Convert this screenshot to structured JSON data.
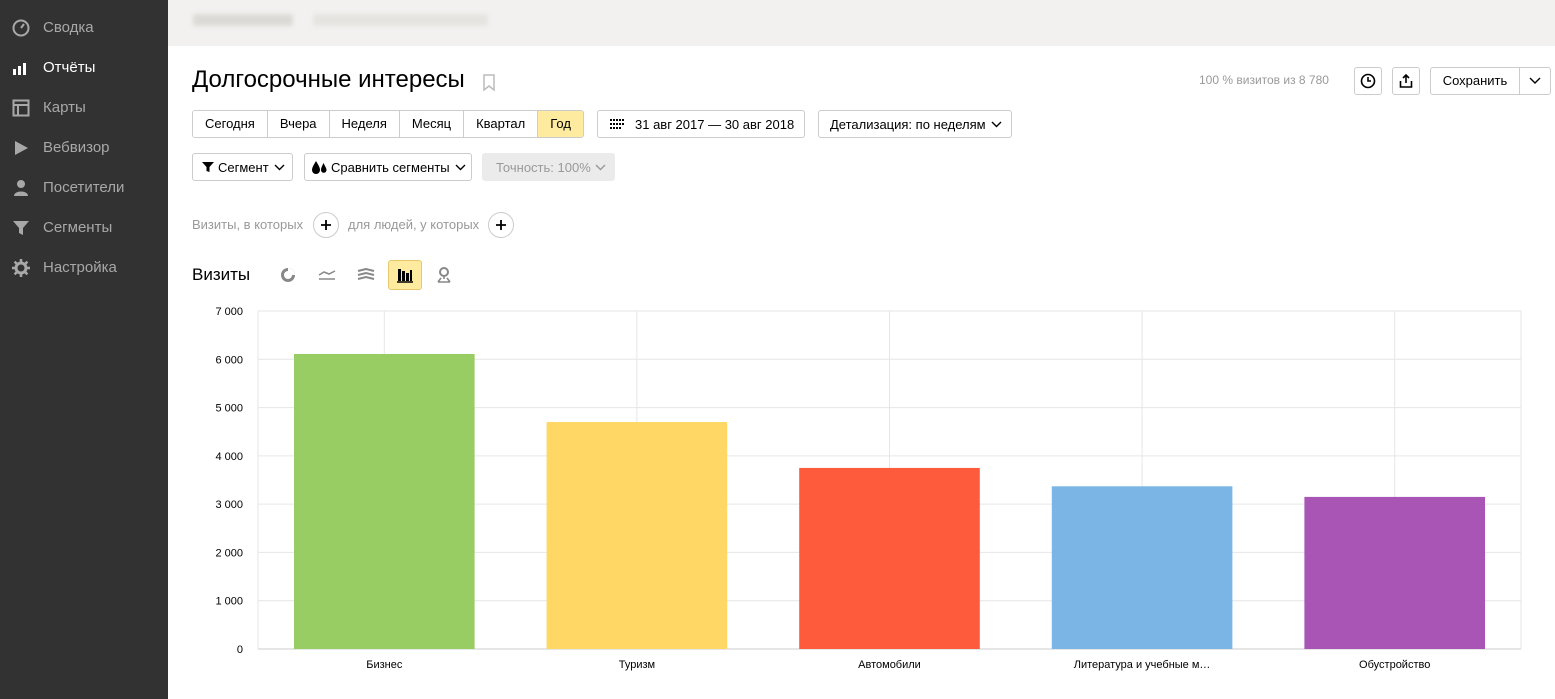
{
  "sidebar": {
    "items": [
      {
        "label": "Сводка",
        "icon": "gauge-icon"
      },
      {
        "label": "Отчёты",
        "icon": "bar-chart-icon",
        "active": true
      },
      {
        "label": "Карты",
        "icon": "map-layout-icon"
      },
      {
        "label": "Вебвизор",
        "icon": "play-icon"
      },
      {
        "label": "Посетители",
        "icon": "person-icon"
      },
      {
        "label": "Сегменты",
        "icon": "funnel-icon"
      },
      {
        "label": "Настройка",
        "icon": "gear-icon"
      }
    ]
  },
  "header": {
    "title": "Долгосрочные интересы",
    "visits_share": "100 % визитов из 8 780",
    "save_label": "Сохранить"
  },
  "period": {
    "options": [
      "Сегодня",
      "Вчера",
      "Неделя",
      "Месяц",
      "Квартал",
      "Год"
    ],
    "selected": "Год",
    "date_range": "31 авг 2017 — 30 авг 2018",
    "detail": "Детализация: по неделям"
  },
  "filters": {
    "segment": "Сегмент",
    "compare": "Сравнить сегменты",
    "accuracy": "Точность: 100%"
  },
  "conditions": {
    "visits_label": "Визиты, в которых",
    "people_label": "для людей, у которых"
  },
  "chart_section": {
    "title": "Визиты",
    "chart_types": [
      "pie-chart-icon",
      "line-chart-icon",
      "area-chart-icon",
      "bar-chart-icon",
      "map-pin-icon"
    ],
    "active_type": "bar-chart-icon"
  },
  "colors": {
    "accent": "#ffeba0",
    "sidebar_bg": "#323232"
  },
  "chart_data": {
    "type": "bar",
    "categories": [
      "Бизнес",
      "Туризм",
      "Автомобили",
      "Литература и учебные м…",
      "Обустройство"
    ],
    "values": [
      6110,
      4700,
      3750,
      3370,
      3150
    ],
    "colors": [
      "#98cd63",
      "#fed764",
      "#fe5a3c",
      "#7ab5e5",
      "#a855b5"
    ],
    "yticks": [
      "0",
      "1 000",
      "2 000",
      "3 000",
      "4 000",
      "5 000",
      "6 000",
      "7 000"
    ],
    "ylim": [
      0,
      7000
    ],
    "grid": true
  }
}
